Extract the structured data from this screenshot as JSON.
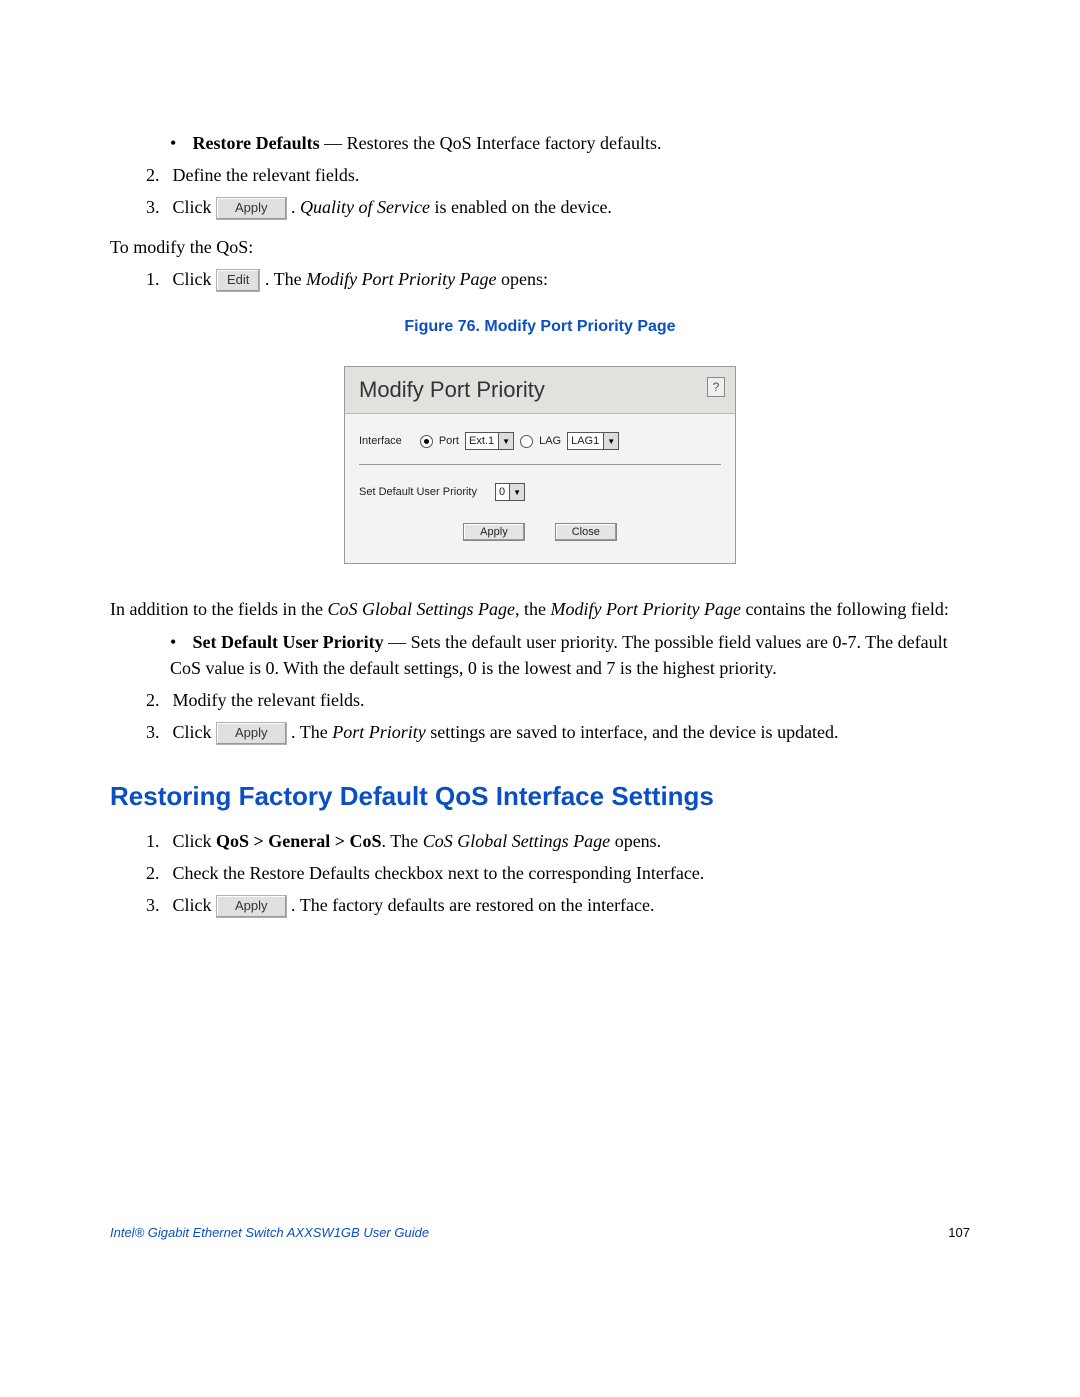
{
  "intro": {
    "restore_bold": "Restore Defaults",
    "restore_rest": " — Restores the QoS Interface factory defaults.",
    "step2": "Define the relevant fields.",
    "step3_pre": "Click ",
    "step3_btn": "Apply",
    "step3_mid": ". ",
    "step3_ital": "Quality of Service",
    "step3_post": " is enabled on the device."
  },
  "modify": {
    "lead": "To modify the QoS:",
    "s1_pre": "Click ",
    "s1_btn": "Edit",
    "s1_mid": ". The ",
    "s1_ital": "Modify Port Priority Page",
    "s1_post": " opens:"
  },
  "figcap": "Figure 76. Modify Port Priority Page",
  "dialog": {
    "title": "Modify Port Priority",
    "interface_label": "Interface",
    "port_label": "Port",
    "port_value": "Ext.1",
    "lag_label": "LAG",
    "lag_value": "LAG1",
    "sdu_label": "Set Default User Priority",
    "sdu_value": "0",
    "apply": "Apply",
    "close": "Close"
  },
  "after": {
    "p1_a": "In addition to the fields in the ",
    "p1_i1": "CoS Global Settings Page",
    "p1_b": ", the ",
    "p1_i2": "Modify Port Priority Page",
    "p1_c": " contains the following field:",
    "sdu_bold": "Set Default User Priority",
    "sdu_rest": " — Sets the default user priority. The possible field values are 0-7. The default CoS value is 0. With the default settings, 0 is the lowest and 7 is the highest priority.",
    "s2": "Modify the relevant fields.",
    "s3_pre": "Click ",
    "s3_btn": "Apply",
    "s3_mid": ". The ",
    "s3_ital": "Port Priority",
    "s3_post": " settings are saved to interface, and the device is updated."
  },
  "section": "Restoring Factory Default QoS Interface Settings",
  "rest": {
    "s1_a": "Click ",
    "s1_bold": "QoS > General > CoS",
    "s1_b": ". The ",
    "s1_ital": "CoS Global Settings Page",
    "s1_c": " opens.",
    "s2": "Check the Restore Defaults checkbox next to the corresponding Interface.",
    "s3_pre": "Click ",
    "s3_btn": "Apply",
    "s3_post": ". The factory defaults are restored on the interface."
  },
  "footer": {
    "left": "Intel® Gigabit Ethernet Switch AXXSW1GB User Guide",
    "page": "107"
  }
}
